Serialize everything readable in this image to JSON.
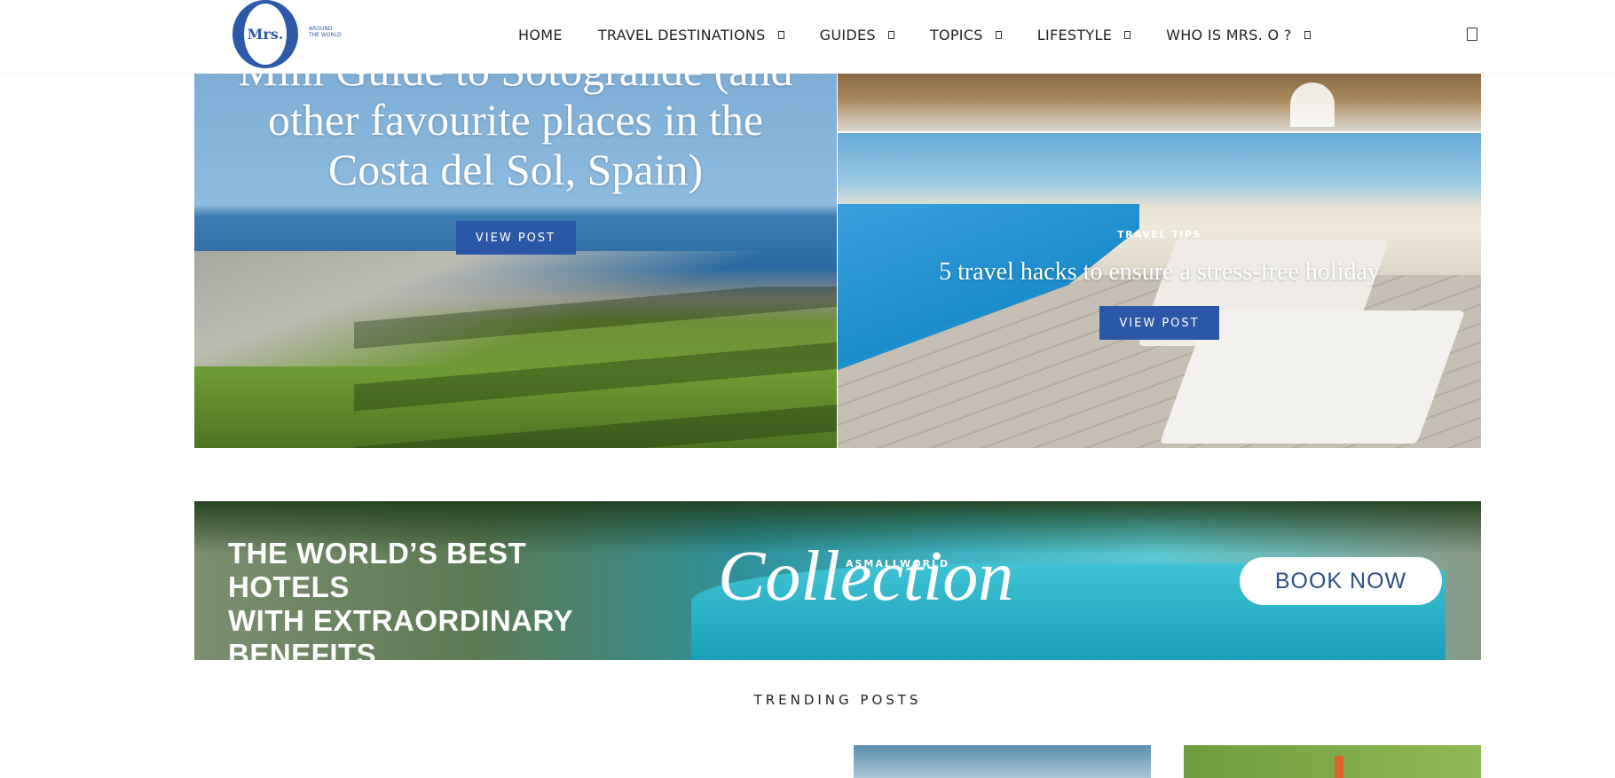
{
  "header": {
    "logo": {
      "mark": "Mrs.",
      "tagline": "AROUND THE WORLD"
    },
    "nav": [
      {
        "label": "HOME",
        "has_dropdown": false
      },
      {
        "label": "TRAVEL DESTINATIONS",
        "has_dropdown": true
      },
      {
        "label": "GUIDES",
        "has_dropdown": true
      },
      {
        "label": "TOPICS",
        "has_dropdown": true
      },
      {
        "label": "LIFESTYLE",
        "has_dropdown": true
      },
      {
        "label": "WHO IS MRS. O ?",
        "has_dropdown": true
      }
    ],
    "cart_icon": "shopping-bag-icon"
  },
  "hero": {
    "left": {
      "title": "Mini Guide to Sotogrande (and other favourite places in the Costa del Sol, Spain)",
      "button": "VIEW POST"
    },
    "right": {
      "category": "TRAVEL TIPS",
      "title": "5 travel hacks to ensure a stress-free holiday",
      "button": "VIEW POST"
    }
  },
  "banner": {
    "headline_lines": [
      "THE WORLD’S BEST HOTELS",
      "WITH EXTRAORDINARY",
      "BENEFITS"
    ],
    "brand_small": "ASMALLWORLD",
    "brand_script": "Collection",
    "cta": "BOOK NOW"
  },
  "trending": {
    "title": "TRENDING POSTS"
  },
  "colors": {
    "accent": "#2b58a6",
    "text": "#222222",
    "background": "#ffffff"
  }
}
